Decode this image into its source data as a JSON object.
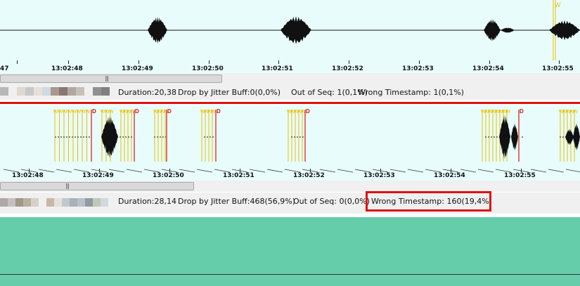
{
  "top_track": {
    "times": [
      "47",
      "13:02:48",
      "13:02:49",
      "13:02:50",
      "13:02:51",
      "13:02:52",
      "13:02:53",
      "13:02:54",
      "13:02:55"
    ],
    "marker_label": "W",
    "stats": {
      "duration": "Duration:20,38",
      "drop": "Drop by Jitter Buff:0(0,0%)",
      "out_of_seq": "Out of Seq: 1(0,1%)",
      "wrong_ts": "Wrong Timestamp: 1(0,1%)"
    }
  },
  "bottom_track": {
    "times": [
      "13:02:48",
      "13:02:49",
      "13:02:50",
      "13:02:51",
      "13:02:52",
      "13:02:53",
      "13:02:54",
      "13:02:55"
    ],
    "marker_label": "W",
    "drop_label": "D",
    "stats": {
      "duration": "Duration:28,14",
      "drop": "Drop by Jitter Buff:468(56,9%)",
      "out_of_seq": "Out of Seq: 0(0,0%)",
      "wrong_ts": "Wrong Timestamp: 160(19,4%)"
    }
  },
  "colors": {
    "wave_bg": "#e8fcfc",
    "marker_yellow": "#e8c000",
    "drop_red": "#e01010",
    "lower_panel": "#66cdaa"
  }
}
